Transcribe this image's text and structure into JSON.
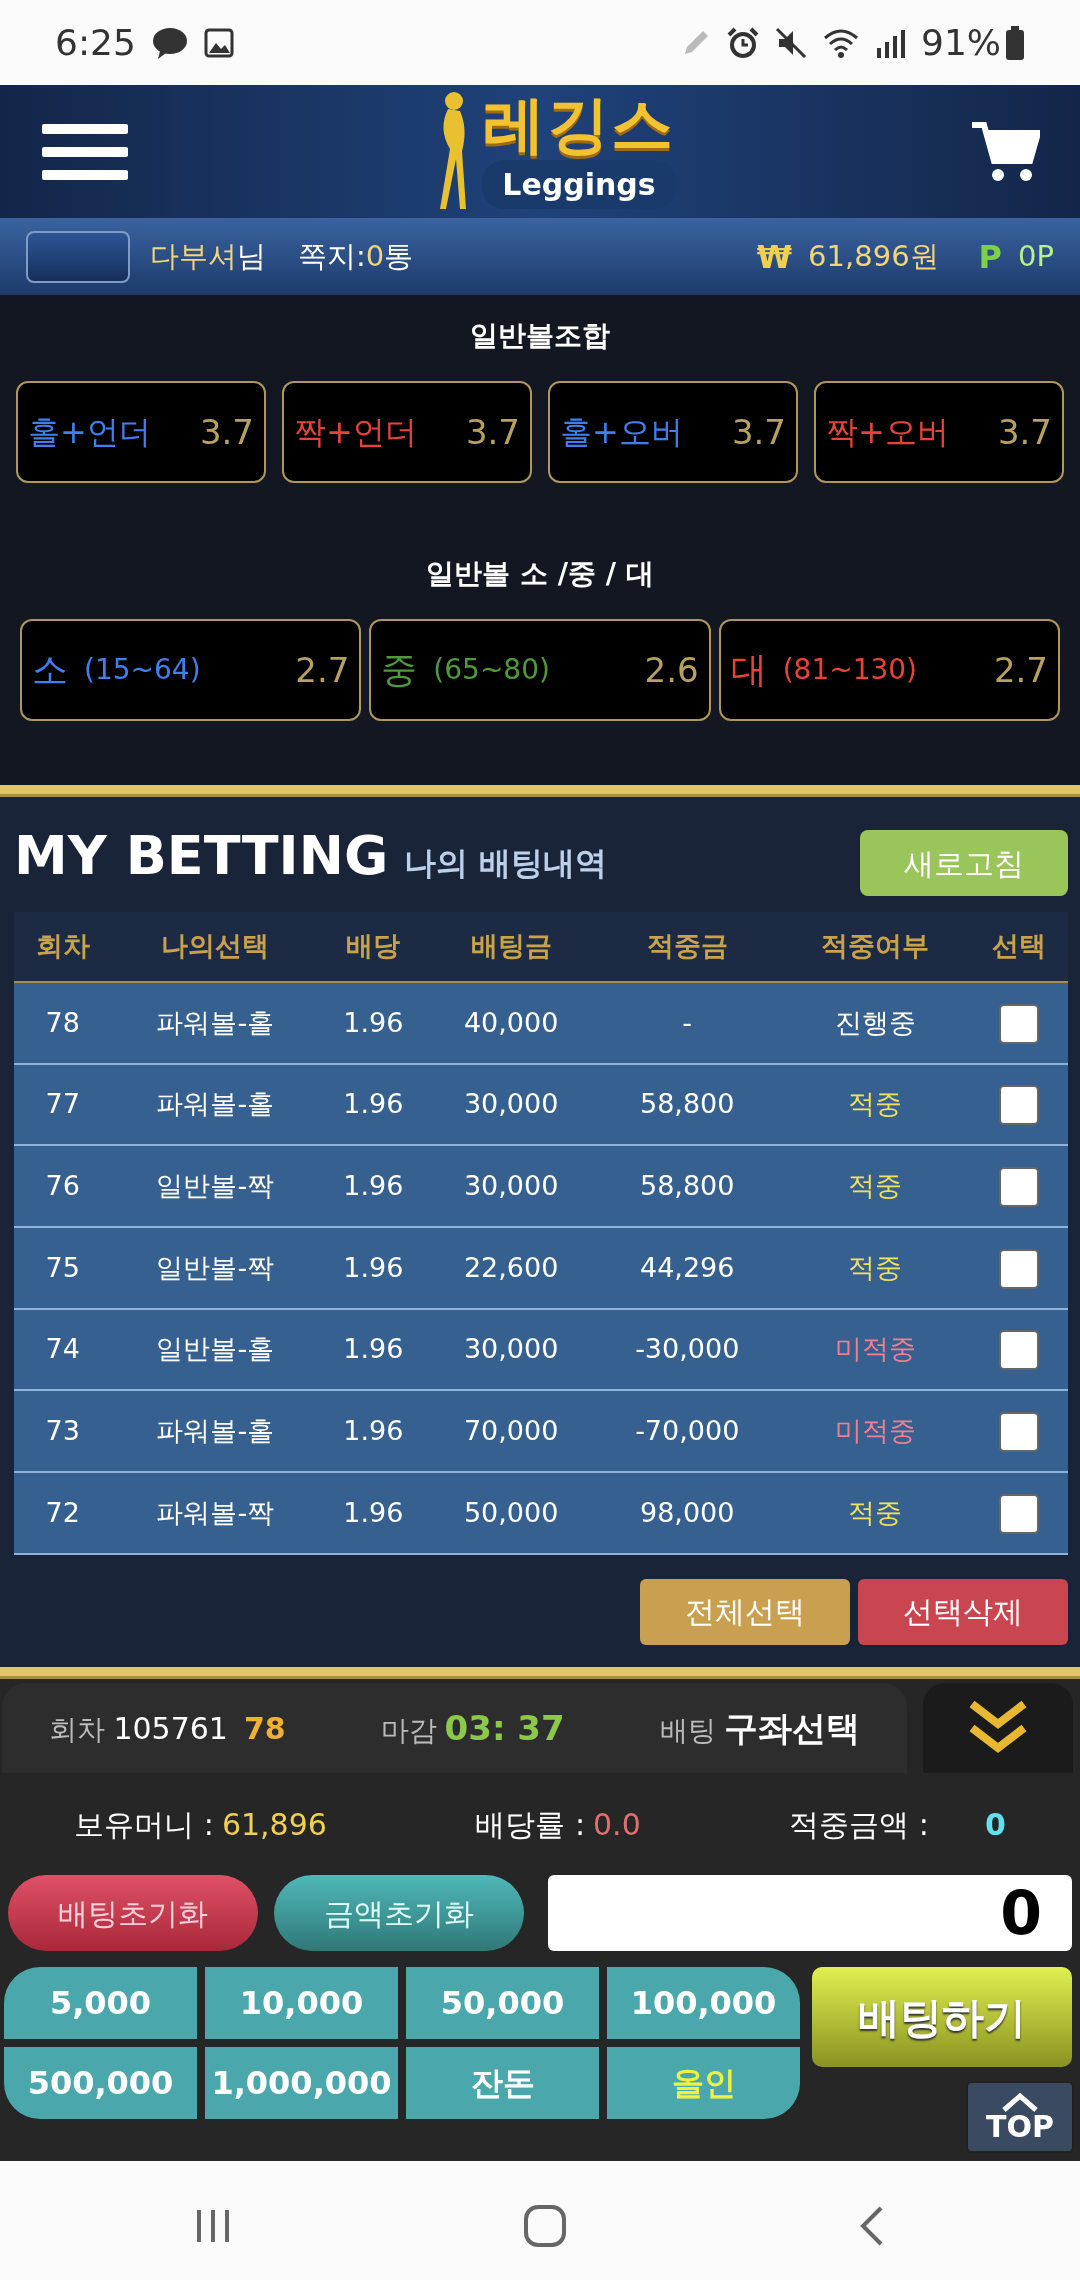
{
  "status_bar": {
    "time": "6:25",
    "battery": "91%"
  },
  "header": {
    "logo_korean": "레깅스",
    "logo_english": "Leggings"
  },
  "user_bar": {
    "nickname": "다부셔",
    "suffix": "님",
    "messages_label": "쪽지:",
    "messages_count": "0",
    "messages_unit": "통",
    "money_symbol": "₩",
    "money": "61,896원",
    "points_symbol": "P",
    "points": "0P"
  },
  "combo_section": {
    "title": "일반볼조합",
    "options": [
      {
        "label": "홀+언더",
        "odds": "3.7",
        "color": "#3f7ff0"
      },
      {
        "label": "짝+언더",
        "odds": "3.7",
        "color": "#e8423a"
      },
      {
        "label": "홀+오버",
        "odds": "3.7",
        "color": "#3f7ff0"
      },
      {
        "label": "짝+오버",
        "odds": "3.7",
        "color": "#e8423a"
      }
    ]
  },
  "size_section": {
    "title": "일반볼 소 /중 / 대",
    "options": [
      {
        "label": "소",
        "range": "(15~64)",
        "odds": "2.7",
        "color": "#3f7ff0"
      },
      {
        "label": "중",
        "range": "(65~80)",
        "odds": "2.6",
        "color": "#4f9a3a"
      },
      {
        "label": "대",
        "range": "(81~130)",
        "odds": "2.7",
        "color": "#e8423a"
      }
    ]
  },
  "my_betting": {
    "title": "MY BETTING",
    "subtitle": "나의 배팅내역",
    "refresh_button": "새로고침",
    "columns": [
      "회차",
      "나의선택",
      "배당",
      "배팅금",
      "적중금",
      "적중여부",
      "선택"
    ],
    "rows": [
      {
        "round": "78",
        "pick": "파워볼-홀",
        "odds": "1.96",
        "amount": "40,000",
        "payout": "-",
        "result": "진행중",
        "color": "#ffffff",
        "checked": false
      },
      {
        "round": "77",
        "pick": "파워볼-홀",
        "odds": "1.96",
        "amount": "30,000",
        "payout": "58,800",
        "result": "적중",
        "color": "#f0e060",
        "checked": false
      },
      {
        "round": "76",
        "pick": "일반볼-짝",
        "odds": "1.96",
        "amount": "30,000",
        "payout": "58,800",
        "result": "적중",
        "color": "#f0e060",
        "checked": false
      },
      {
        "round": "75",
        "pick": "일반볼-짝",
        "odds": "1.96",
        "amount": "22,600",
        "payout": "44,296",
        "result": "적중",
        "color": "#f0e060",
        "checked": false
      },
      {
        "round": "74",
        "pick": "일반볼-홀",
        "odds": "1.96",
        "amount": "30,000",
        "payout": "-30,000",
        "result": "미적중",
        "color": "#f08090",
        "checked": false
      },
      {
        "round": "73",
        "pick": "파워볼-홀",
        "odds": "1.96",
        "amount": "70,000",
        "payout": "-70,000",
        "result": "미적중",
        "color": "#f08090",
        "checked": false
      },
      {
        "round": "72",
        "pick": "파워볼-짝",
        "odds": "1.96",
        "amount": "50,000",
        "payout": "98,000",
        "result": "적중",
        "color": "#f0e060",
        "checked": false
      }
    ],
    "select_all_button": "전체선택",
    "delete_button": "선택삭제"
  },
  "bet_panel": {
    "round_label": "회차",
    "round_number": "105761",
    "round_sub": "78",
    "deadline_label": "마감",
    "deadline": "03: 37",
    "bet_label": "배팅",
    "bet_value": "구좌선택",
    "balance_label": "보유머니 :",
    "balance": "61,896",
    "rate_label": "배당률 :",
    "rate": "0.0",
    "win_label": "적중금액 :",
    "win_amount": "0",
    "reset_bet_button": "배팅초기화",
    "reset_amount_button": "금액초기화",
    "amount_value": "0",
    "chips": [
      {
        "label": "5,000",
        "kind": "amount"
      },
      {
        "label": "10,000",
        "kind": "amount"
      },
      {
        "label": "50,000",
        "kind": "amount"
      },
      {
        "label": "100,000",
        "kind": "amount"
      },
      {
        "label": "500,000",
        "kind": "amount"
      },
      {
        "label": "1,000,000",
        "kind": "amount"
      },
      {
        "label": "잔돈",
        "kind": "amount"
      },
      {
        "label": "올인",
        "kind": "allin"
      }
    ],
    "bet_button": "배팅하기",
    "top_button": "TOP"
  }
}
